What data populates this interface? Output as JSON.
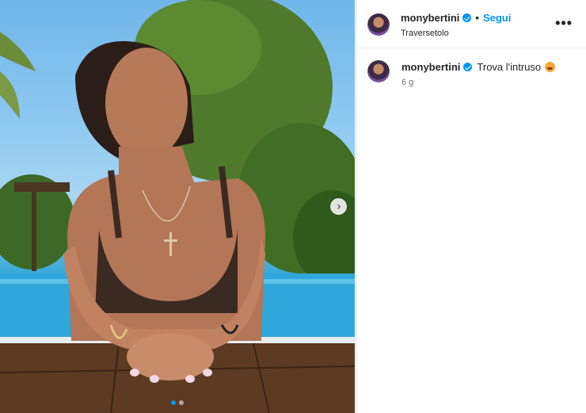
{
  "post": {
    "username": "monybertini",
    "separator": "•",
    "follow_label": "Segui",
    "location": "Traversetolo",
    "more_label": "•••",
    "caption": "Trova l'intruso",
    "time_ago": "6 g",
    "carousel_total": 2,
    "carousel_index": 1
  },
  "icons": {
    "verified": "verified-badge-icon",
    "next": "chevron-right-icon",
    "emoji": "smiling-face-emoji-icon"
  },
  "colors": {
    "accent": "#0095f6",
    "text": "#262626",
    "muted": "#737373"
  }
}
